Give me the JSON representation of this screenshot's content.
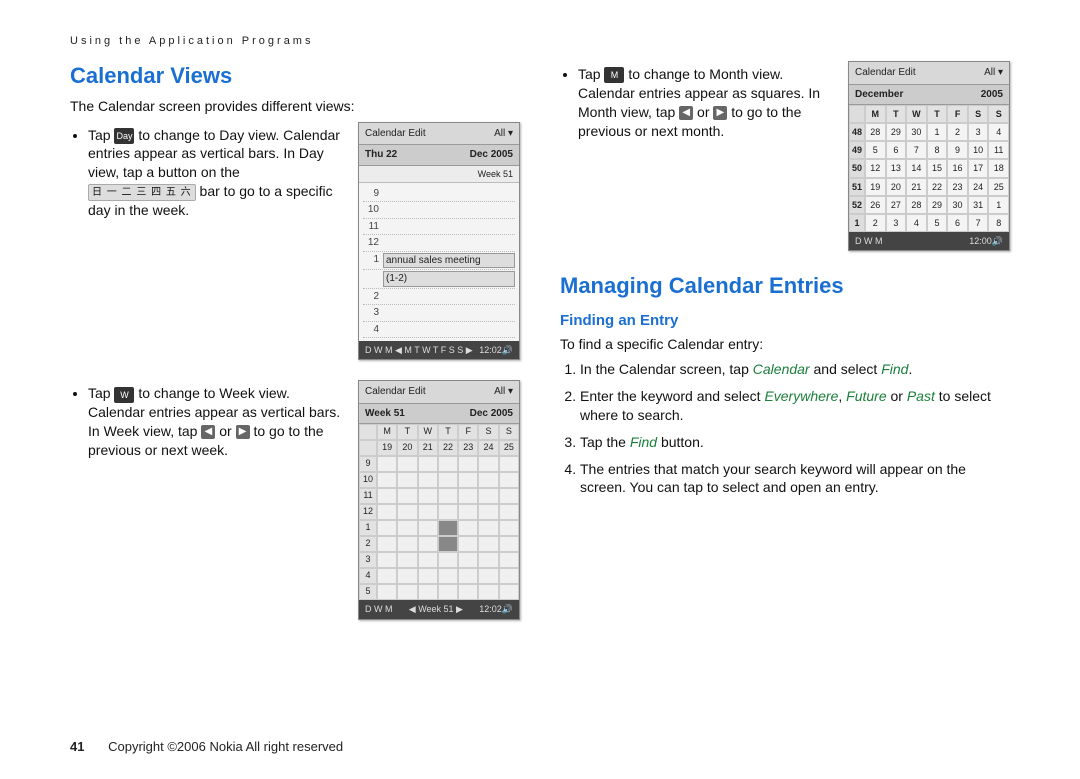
{
  "running_head": "Using the Application Programs",
  "left": {
    "h2": "Calendar Views",
    "intro": "The Calendar screen provides different views:",
    "b1a": "Tap ",
    "b1b": " to change to Day view. Calendar entries appear as vertical bars. In Day view, tap a button on the ",
    "b1c": " bar to go to a specific day in the week.",
    "b2a": "Tap ",
    "b2b": " to change to Week view. Calendar entries appear as vertical bars. In Week view, tap ",
    "b2c": " or ",
    "b2d": " to go to the previous or next week.",
    "icon_day": "Day",
    "icon_week": "W",
    "daybar": "日 一 二 三 四 五 六",
    "arrow_l": "◀",
    "arrow_r": "▶"
  },
  "right": {
    "b1a": "Tap ",
    "b1b": " to change to Month view. Calendar entries appear as squares. In Month view, tap ",
    "b1c": " or ",
    "b1d": " to go to the previous or next month.",
    "icon_month": "M",
    "arrow_l": "◀",
    "arrow_r": "▶",
    "h2": "Managing Calendar Entries",
    "h3": "Finding an Entry",
    "intro": "To find a specific Calendar entry:",
    "s1a": "In the Calendar screen, tap ",
    "s1b": " and select ",
    "s1c": ".",
    "s1_em1": "Calendar",
    "s1_em2": "Find",
    "s2a": "Enter the keyword and select ",
    "s2b": ", ",
    "s2c": " or ",
    "s2d": " to select where to search.",
    "s2_em1": "Everywhere",
    "s2_em2": "Future",
    "s2_em3": "Past",
    "s3a": "Tap the ",
    "s3b": " button.",
    "s3_em1": "Find",
    "s4": "The entries that match your search keyword will appear on the screen. You can tap to select and open an entry."
  },
  "ss_day": {
    "menu_l": "Calendar  Edit",
    "menu_r": "All ▾",
    "title_l": "Thu 22",
    "title_r": "Dec 2005",
    "sub": "Week 51",
    "hours": [
      "9",
      "10",
      "11",
      "12",
      "1",
      "2",
      "3",
      "4"
    ],
    "entry": "annual sales meeting",
    "entry2": "(1-2)",
    "foot_l": "D W M  ◀ M T W T F S S ▶",
    "foot_r": "12:02🔊"
  },
  "ss_week": {
    "menu_l": "Calendar  Edit",
    "menu_r": "All ▾",
    "title_l": "Week 51",
    "title_r": "Dec 2005",
    "dow": [
      "M",
      "T",
      "W",
      "T",
      "F",
      "S",
      "S"
    ],
    "dates": [
      "19",
      "20",
      "21",
      "22",
      "23",
      "24",
      "25"
    ],
    "hours": [
      "9",
      "10",
      "11",
      "12",
      "1",
      "2",
      "3",
      "4",
      "5"
    ],
    "foot_l": "D W M",
    "foot_c": "◀  Week 51  ▶",
    "foot_r": "12:02🔊"
  },
  "ss_month": {
    "menu_l": "Calendar  Edit",
    "menu_r": "All ▾",
    "title_l": "December",
    "title_r": "2005",
    "dow": [
      "M",
      "T",
      "W",
      "T",
      "F",
      "S",
      "S"
    ],
    "weeks": [
      {
        "wk": "48",
        "d": [
          "28",
          "29",
          "30",
          "1",
          "2",
          "3",
          "4"
        ]
      },
      {
        "wk": "49",
        "d": [
          "5",
          "6",
          "7",
          "8",
          "9",
          "10",
          "11"
        ]
      },
      {
        "wk": "50",
        "d": [
          "12",
          "13",
          "14",
          "15",
          "16",
          "17",
          "18"
        ]
      },
      {
        "wk": "51",
        "d": [
          "19",
          "20",
          "21",
          "22",
          "23",
          "24",
          "25"
        ]
      },
      {
        "wk": "52",
        "d": [
          "26",
          "27",
          "28",
          "29",
          "30",
          "31",
          "1"
        ]
      },
      {
        "wk": "1",
        "d": [
          "2",
          "3",
          "4",
          "5",
          "6",
          "7",
          "8"
        ]
      }
    ],
    "foot_l": "D W M",
    "foot_r": "12:00🔊"
  },
  "footer": {
    "page": "41",
    "copy": "Copyright ©2006 Nokia All right reserved"
  }
}
